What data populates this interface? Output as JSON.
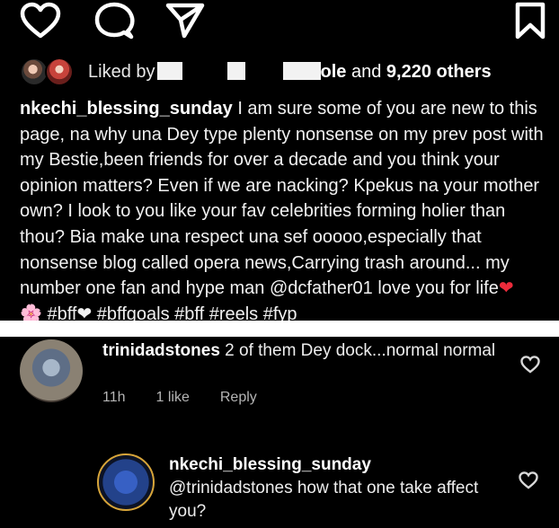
{
  "actions": {
    "like_icon": "heart-outline-icon",
    "comment_icon": "comment-bubble-icon",
    "share_icon": "paper-plane-icon",
    "save_icon": "bookmark-icon"
  },
  "likes": {
    "prefix": "Liked by",
    "suffix_name_fragment": "ole",
    "and_text": " and ",
    "count_text": "9,220 others"
  },
  "caption": {
    "username": "nkechi_blessing_sunday",
    "text": " I am sure some of you are new to this page, na why una Dey type plenty nonsense on my prev post with my Bestie,been friends for over a decade and you think your opinion matters? Even if we are nacking? Kpekus na your mother own? I look to you like your fav celebrities forming holier than thou? Bia make una respect una sef ooooo,especially that nonsense blog called opera news,Carrying trash around... my number one fan and hype man @dcfather01 love you for life",
    "heart_emoji": "❤",
    "tags_line": "🌸 #bff❤ #bffgoals #bff #reels #fyp"
  },
  "comments": [
    {
      "username": "trinidadstones",
      "text": " 2 of them Dey dock...normal normal",
      "time": "11h",
      "likes": "1 like",
      "reply": "Reply"
    },
    {
      "username": "nkechi_blessing_sunday",
      "text": "@trinidadstones how that one take affect you?"
    }
  ],
  "colors": {
    "background": "#000000",
    "heart_red": "#ed2b3b",
    "meta_gray": "#b5b5b5"
  }
}
